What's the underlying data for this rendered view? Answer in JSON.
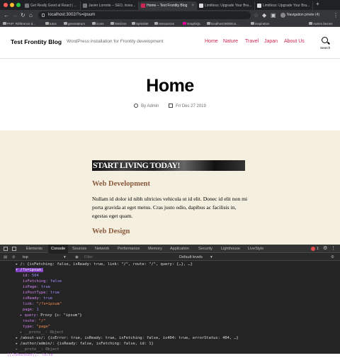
{
  "browser": {
    "tabs": [
      {
        "title": "Get Really Good at React | ..."
      },
      {
        "title": "Javier Lorente – SEO, inves..."
      },
      {
        "title": "Home – Test Frontity Blog"
      },
      {
        "title": "Limitless: Upgrade Your Bra..."
      },
      {
        "title": "Limitless: Upgrade Your Bra..."
      }
    ],
    "url": "localhost:3002/?s=ipsum",
    "private_label": "Navigation privée (4)",
    "bookmarks": [
      "PHP: Référence d...",
      "tutos",
      "generateurs",
      "icons",
      "html/css",
      "Sprinklet",
      "ressources",
      "GraphiQL",
      "localhost:8000/ca...",
      "inspiration",
      "Autres favoris"
    ]
  },
  "site": {
    "title": "Test Frontity Blog",
    "description": "WordPress installation for Frontity development",
    "menu": [
      "Home",
      "Nature",
      "Travel",
      "Japan",
      "About Us"
    ],
    "search_label": "Search"
  },
  "page": {
    "title": "Home",
    "author": "By Admin",
    "date": "Fri Dec 27 2019"
  },
  "content": {
    "banner_text": "START LIVING TODAY!",
    "heading1": "Web Development",
    "paragraph": "Nullam id dolor id nibh ultricies vehicula ut id elit. Donec id elit non mi porta gravida at eget metus. Cras justo odio, dapibus ac facilisis in, egestas eget quam.",
    "heading2": "Web Design"
  },
  "devtools": {
    "tabs": [
      "Elements",
      "Console",
      "Sources",
      "Network",
      "Performance",
      "Memory",
      "Application",
      "Security",
      "Lighthouse",
      "LiveStyle"
    ],
    "active_tab": "Console",
    "error_count": "1",
    "context": "top",
    "filter_placeholder": "Filter",
    "levels": "Default levels",
    "lines": {
      "l0": "▸ /: {isFetching: false, isReady: true, link: \"/\", route: \"/\", query: {…}, …}",
      "l1": "▾ /?s=ipsum:",
      "l2_k": "id:",
      "l2_v": "504",
      "l3_k": "isFetching:",
      "l3_v": "false",
      "l4_k": "isPage:",
      "l4_v": "true",
      "l5_k": "isPostType:",
      "l5_v": "true",
      "l6_k": "isReady:",
      "l6_v": "true",
      "l7_k": "link:",
      "l7_v": "\"/?s=ipsum\"",
      "l8_k": "page:",
      "l8_v": "1",
      "l9_k": "▸ query:",
      "l9_v": "Proxy {s: \"ipsum\"}",
      "l10_k": "route:",
      "l10_v": "\"/\"",
      "l11_k": "type:",
      "l11_v": "\"page\"",
      "l12": "▸ __proto__: Object",
      "l13": "▸ /about-us/: {isError: true, isReady: true, isFetching: false, is404: true, errorStatus: 404, …}",
      "l14": "▸ /author/admin/: {isReady: false, isFetching: false, id: 1}",
      "l15": "▸ __proto__: Object",
      "l16": "[[IsRevoked]]: false"
    }
  }
}
